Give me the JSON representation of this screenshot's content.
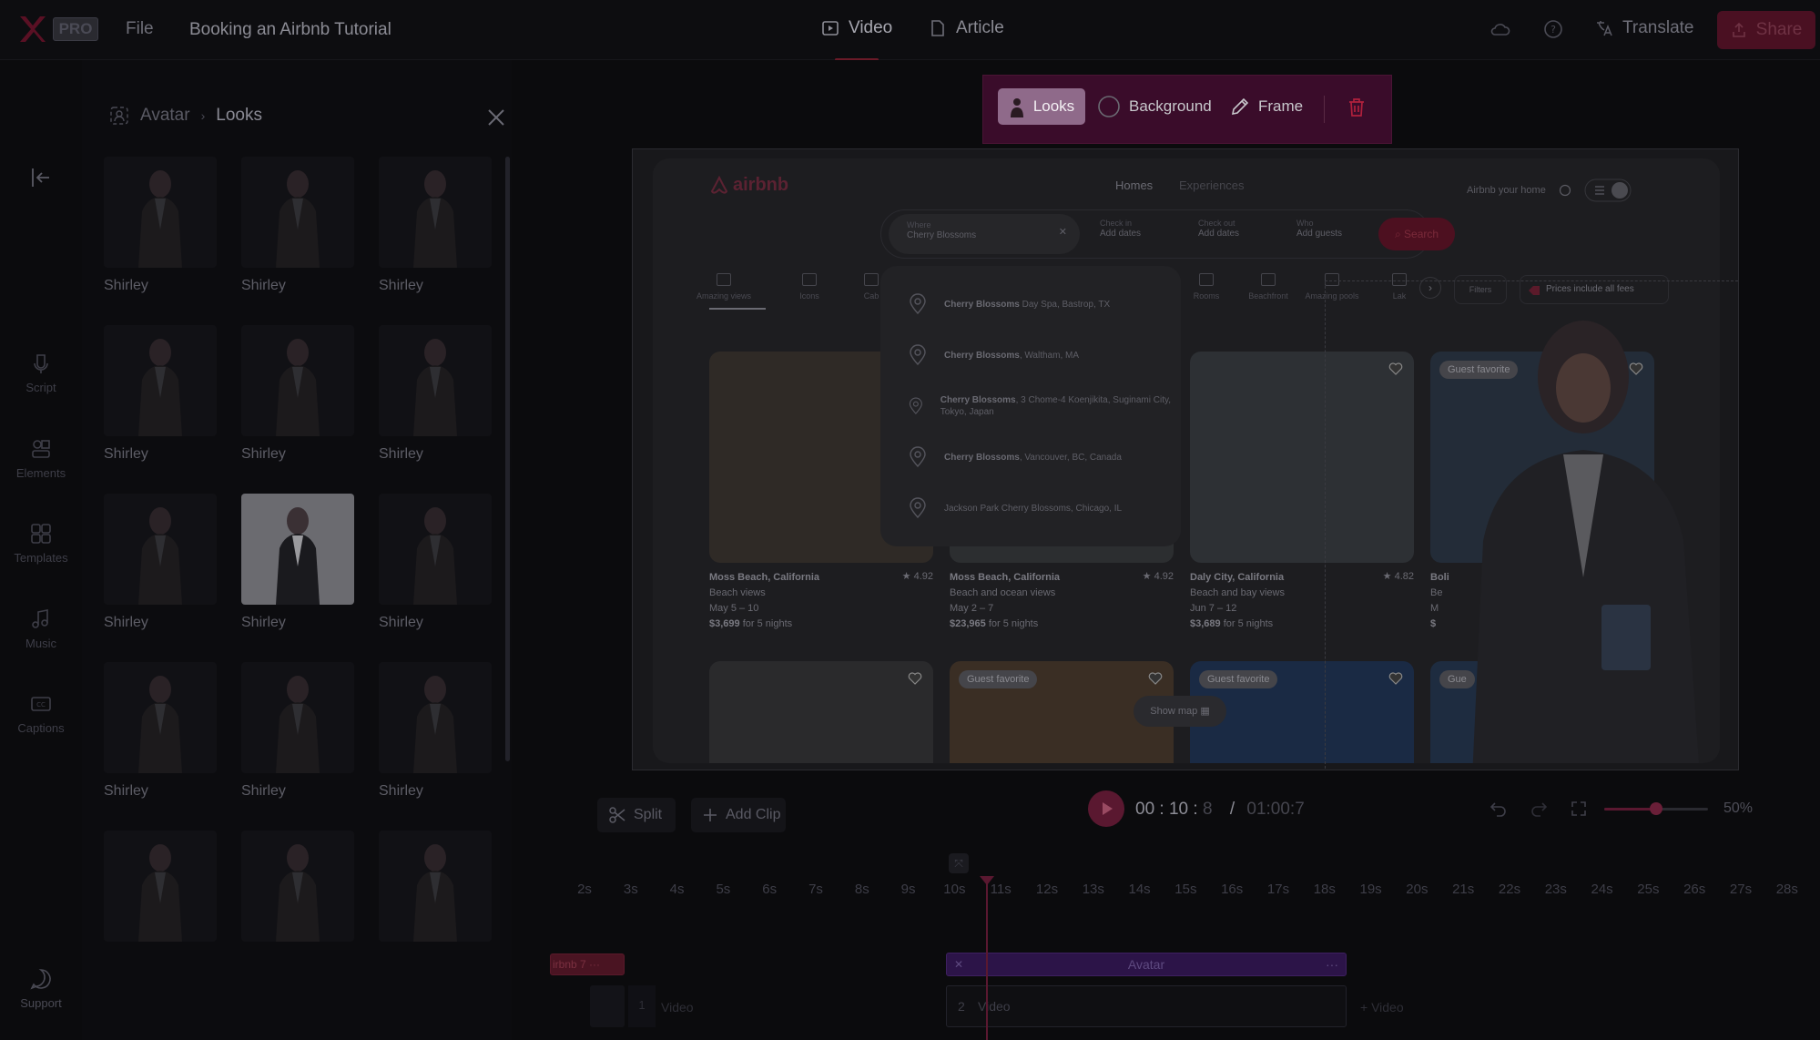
{
  "header": {
    "badge": "PRO",
    "file_menu": "File",
    "project_title": "Booking an Airbnb Tutorial",
    "modes": [
      {
        "label": "Video",
        "active": true
      },
      {
        "label": "Article",
        "active": false
      }
    ],
    "translate_label": "Translate",
    "share_label": "Share",
    "accent_color": "#e0245e"
  },
  "rail": {
    "items": [
      {
        "label": "Script",
        "icon": "script-icon"
      },
      {
        "label": "Elements",
        "icon": "elements-icon"
      },
      {
        "label": "Templates",
        "icon": "templates-icon"
      },
      {
        "label": "Music",
        "icon": "music-icon"
      },
      {
        "label": "Captions",
        "icon": "captions-icon"
      }
    ],
    "support_label": "Support"
  },
  "panel": {
    "breadcrumb": {
      "parent": "Avatar",
      "current": "Looks"
    },
    "looks": [
      {
        "name": "Shirley",
        "selected": false
      },
      {
        "name": "Shirley",
        "selected": false
      },
      {
        "name": "Shirley",
        "selected": false
      },
      {
        "name": "Shirley",
        "selected": false
      },
      {
        "name": "Shirley",
        "selected": false
      },
      {
        "name": "Shirley",
        "selected": false
      },
      {
        "name": "Shirley",
        "selected": false
      },
      {
        "name": "Shirley",
        "selected": true
      },
      {
        "name": "Shirley",
        "selected": false
      },
      {
        "name": "Shirley",
        "selected": false
      },
      {
        "name": "Shirley",
        "selected": false
      },
      {
        "name": "Shirley",
        "selected": false
      },
      {
        "name": "",
        "selected": false
      },
      {
        "name": "",
        "selected": false
      },
      {
        "name": "",
        "selected": false
      }
    ]
  },
  "toolbar": {
    "looks_label": "Looks",
    "background_label": "Background",
    "frame_label": "Frame"
  },
  "preview": {
    "logo_text": "airbnb",
    "nav": {
      "homes": "Homes",
      "experiences": "Experiences",
      "host": "Airbnb your home"
    },
    "search": {
      "where_label": "Where",
      "where_value": "Cherry Blossoms",
      "checkin_label": "Check in",
      "checkin_value": "Add dates",
      "checkout_label": "Check out",
      "checkout_value": "Add dates",
      "who_label": "Who",
      "who_value": "Add guests",
      "button": "Search"
    },
    "suggestions": [
      {
        "bold": "Cherry Blossoms",
        "rest": " Day Spa, Bastrop, TX"
      },
      {
        "bold": "Cherry Blossoms",
        "rest": ", Waltham, MA"
      },
      {
        "bold": "Cherry Blossoms",
        "rest": ", 3 Chome-4 Koenjikita, Suginami City, Tokyo, Japan"
      },
      {
        "bold": "Cherry Blossoms",
        "rest": ", Vancouver, BC, Canada"
      },
      {
        "bold": "",
        "rest": "Jackson Park Cherry Blossoms, Chicago, IL"
      }
    ],
    "categories": [
      "Amazing views",
      "Icons",
      "Cab",
      "Rooms",
      "Beachfront",
      "Amazing pools",
      "Lak"
    ],
    "filters": "Filters",
    "prices_note": "Prices include all fees",
    "listings": [
      {
        "place": "Moss Beach, California",
        "rating": "★ 4.92",
        "desc": "Beach views",
        "dates": "May 5 – 10",
        "price": "$3,699",
        "nights": " for 5 nights",
        "badge": ""
      },
      {
        "place": "Moss Beach, California",
        "rating": "★ 4.92",
        "desc": "Beach and ocean views",
        "dates": "May 2 – 7",
        "price": "$23,965",
        "nights": " for 5 nights",
        "badge": ""
      },
      {
        "place": "Daly City, California",
        "rating": "★ 4.82",
        "desc": "Beach and bay views",
        "dates": "Jun 7 – 12",
        "price": "$3,689",
        "nights": " for 5 nights",
        "badge": ""
      },
      {
        "place": "Boli",
        "rating": "",
        "desc": "Be",
        "dates": "M",
        "price": "$",
        "nights": "",
        "badge": "Guest favorite"
      }
    ],
    "row2_badges": [
      "",
      "Guest favorite",
      "Guest favorite",
      "Gue"
    ],
    "show_map": "Show map"
  },
  "controls": {
    "split": "Split",
    "add_clip": "Add Clip",
    "time_current_a": "00",
    "time_current_b": "10",
    "time_current_c": "8",
    "time_sep": ":",
    "time_slash": "/",
    "time_total": "01:00:7",
    "zoom_pct": "50%",
    "zoom_level": 0.5
  },
  "timeline": {
    "ticks": [
      "2s",
      "3s",
      "4s",
      "5s",
      "6s",
      "7s",
      "8s",
      "9s",
      "10s",
      "11s",
      "12s",
      "13s",
      "14s",
      "15s",
      "16s",
      "17s",
      "18s",
      "19s",
      "20s",
      "21s",
      "22s",
      "23s",
      "24s",
      "25s",
      "26s",
      "27s",
      "28s"
    ],
    "clip_red_label": "irbnb 7 ···",
    "avatar_clip_label": "Avatar",
    "video_clip_label": "Video",
    "video_clip_num": "2",
    "video2_label": "Video",
    "left_clip_label": "Video",
    "left_clip_num": "1"
  }
}
